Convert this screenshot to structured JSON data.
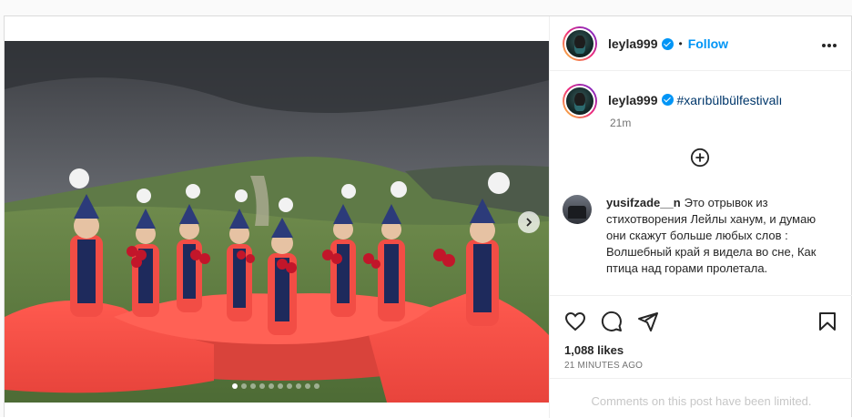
{
  "post": {
    "author": {
      "username": "leyla999",
      "verified": true,
      "follow_label": "Follow",
      "separator": "•",
      "avatar": "avatar-icon"
    },
    "caption": {
      "username": "leyla999",
      "hashtag": "#xarıbülbülfestivalı",
      "time": "21m"
    },
    "comment": {
      "username": "yusifzade__n",
      "text": "Это отрывок из стихотворения Лейлы ханум, и думаю они скажут больше любых слов : Волшебный край я видела во сне, Как птица над горами пролетала."
    },
    "likes": "1,088 likes",
    "posted_ago": "21 MINUTES AGO",
    "comments_limited": "Comments on this post have been limited.",
    "carousel": {
      "total": 10,
      "active_index": 0
    }
  },
  "icons": {
    "more": "more-options-icon",
    "add_comment": "plus-circle-icon",
    "like": "heart-icon",
    "comment": "comment-icon",
    "share": "share-icon",
    "save": "bookmark-icon",
    "next": "chevron-right-icon"
  },
  "colors": {
    "accent": "#0095f6",
    "hashtag": "#00376b",
    "dress": "#f24d45",
    "vest": "#1e2a5c"
  }
}
